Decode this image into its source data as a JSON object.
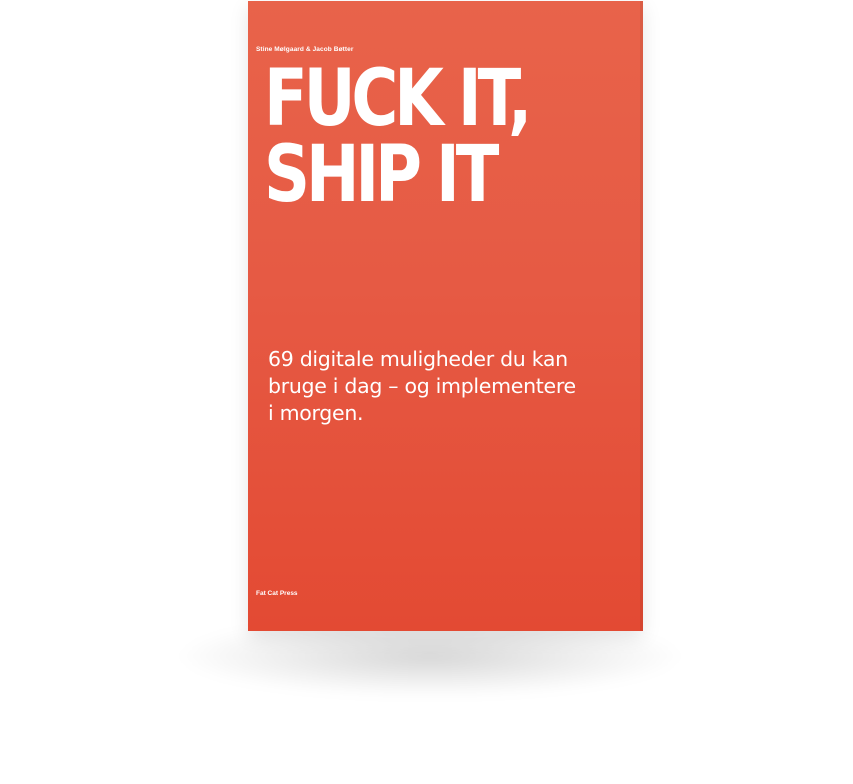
{
  "book": {
    "authors": "Stine Mølgaard  & Jacob Bøtter",
    "title_lines": [
      "FUCK IT,",
      "SHIP IT"
    ],
    "subtitle_lines": [
      "69 digitale muligheder du kan",
      "bruge i dag – og implementere",
      "i morgen."
    ],
    "publisher": "Fat Cat Press",
    "cover_color": "#e65a44",
    "text_color": "#ffffff"
  }
}
